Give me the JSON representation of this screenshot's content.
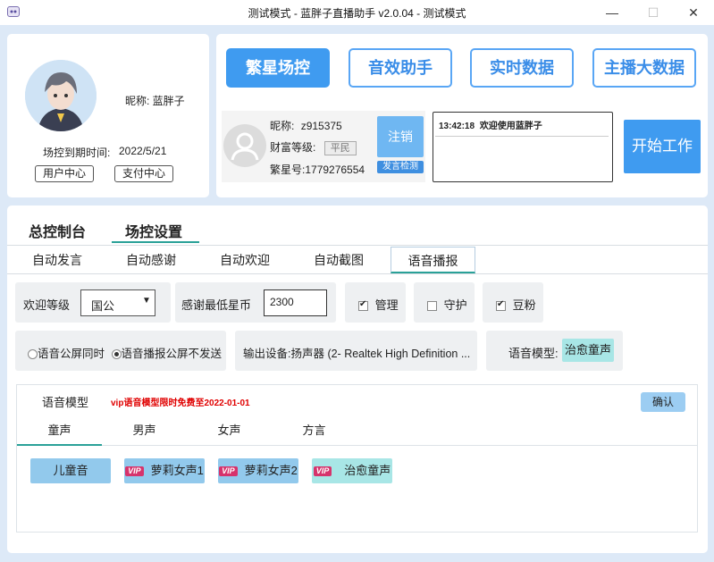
{
  "window": {
    "title": "测试模式 - 蓝胖子直播助手 v2.0.04 - 测试模式",
    "minimize": "—",
    "maximize": "☐",
    "close": "✕"
  },
  "profile": {
    "nickname": "昵称: 蓝胖子",
    "expiry_label": "场控到期时间:",
    "expiry_date": "2022/5/21",
    "user_center": "用户中心",
    "pay_center": "支付中心"
  },
  "nav": {
    "buttons": [
      "繁星场控",
      "音效助手",
      "实时数据",
      "主播大数据"
    ]
  },
  "account": {
    "nickname_label": "昵称:",
    "nickname": "z915375",
    "wealth_label": "财富等级:",
    "wealth_rank": "平民",
    "star_id_label": "繁星号:",
    "star_id": "1779276554",
    "logout": "注销",
    "speech_check": "发言检测"
  },
  "log": {
    "time": "13:42:18",
    "message": "欢迎使用蓝胖子"
  },
  "start_button": "开始工作",
  "main_tabs": [
    "总控制台",
    "场控设置"
  ],
  "sub_tabs": [
    "自动发言",
    "自动感谢",
    "自动欢迎",
    "自动截图",
    "语音播报"
  ],
  "settings": {
    "welcome_level_label": "欢迎等级",
    "welcome_level_value": "国公",
    "min_coin_label": "感谢最低星币",
    "min_coin_value": "2300",
    "admin_label": "管理",
    "admin_checked": true,
    "guard_label": "守护",
    "guard_checked": false,
    "fans_label": "豆粉",
    "fans_checked": true,
    "radio_1": "语音公屏同时",
    "radio_2": "语音播报公屏不发送",
    "radio_selected": 2,
    "output_device": "输出设备:扬声器 (2- Realtek High Definition ...",
    "voice_model_label": "语音模型:",
    "voice_model_value": "治愈童声"
  },
  "voice_panel": {
    "title": "语音模型",
    "promo": "vip语音模型限时免费至2022-01-01",
    "confirm": "确认",
    "tabs": [
      "童声",
      "男声",
      "女声",
      "方言"
    ],
    "vip_badge": "VIP",
    "options": [
      "儿童音",
      "萝莉女声1",
      "萝莉女声2",
      "治愈童声"
    ]
  },
  "colors": {
    "accent_blue": "#3f9bf0",
    "teal_underline": "#2aa198",
    "promo_red": "#e00000",
    "vip_pink": "#d6336c"
  }
}
